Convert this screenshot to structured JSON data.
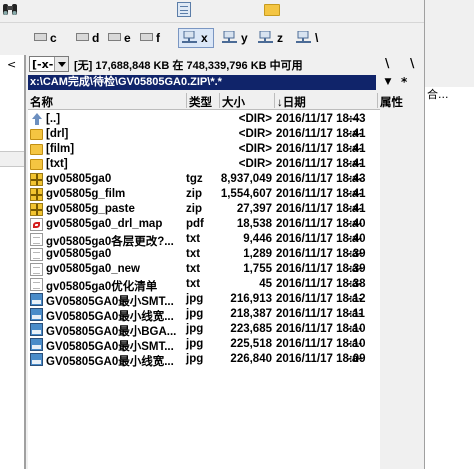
{
  "toolbar": {
    "icons": [
      "binoculars-icon",
      "calculator-icon",
      "folder-icon"
    ]
  },
  "drives": [
    {
      "letter": "c",
      "selected": false
    },
    {
      "letter": "d",
      "selected": false
    },
    {
      "letter": "e",
      "selected": false
    },
    {
      "letter": "f",
      "selected": false
    },
    {
      "letter": "x",
      "selected": true
    },
    {
      "letter": "y",
      "selected": false
    },
    {
      "letter": "z",
      "selected": false
    },
    {
      "letter": "\\",
      "selected": false
    }
  ],
  "drive_combo": {
    "value": "[-x-]"
  },
  "drive_info": "[无] 17,688,848 KB 在 748,339,796 KB 中可用",
  "path_bar": {
    "path": "x:\\CAM完成\\待检\\GV05805GA0.ZIP\\*.*",
    "star": "*",
    "backslash": "\\",
    "dropdown": "▼"
  },
  "right_panel": {
    "text": "合..."
  },
  "left_pane": {
    "arrow": "<"
  },
  "columns": {
    "name": "名称",
    "ext": "类型",
    "size": "大小",
    "date": "↓日期",
    "attr": "属性"
  },
  "files": [
    {
      "icon": "up",
      "name": "[..]",
      "ext": "",
      "size": "<DIR>",
      "date": "2016/11/17 18:43",
      "attr": "—"
    },
    {
      "icon": "folder",
      "name": "[drl]",
      "ext": "",
      "size": "<DIR>",
      "date": "2016/11/17 18:41",
      "attr": "-a-"
    },
    {
      "icon": "folder",
      "name": "[film]",
      "ext": "",
      "size": "<DIR>",
      "date": "2016/11/17 18:41",
      "attr": "-a-"
    },
    {
      "icon": "folder",
      "name": "[txt]",
      "ext": "",
      "size": "<DIR>",
      "date": "2016/11/17 18:41",
      "attr": "-a-"
    },
    {
      "icon": "zip",
      "name": "gv05805ga0",
      "ext": "tgz",
      "size": "8,937,049",
      "date": "2016/11/17 18:43",
      "attr": "-a-"
    },
    {
      "icon": "zip",
      "name": "gv05805g_film",
      "ext": "zip",
      "size": "1,554,607",
      "date": "2016/11/17 18:41",
      "attr": "-a-"
    },
    {
      "icon": "zip",
      "name": "gv05805g_paste",
      "ext": "zip",
      "size": "27,397",
      "date": "2016/11/17 18:41",
      "attr": "-a-"
    },
    {
      "icon": "pdf",
      "name": "gv05805ga0_drl_map",
      "ext": "pdf",
      "size": "18,538",
      "date": "2016/11/17 18:40",
      "attr": "-a-"
    },
    {
      "icon": "txt",
      "name": "gv05805ga0各层更改?...",
      "ext": "txt",
      "size": "9,446",
      "date": "2016/11/17 18:40",
      "attr": "-a-"
    },
    {
      "icon": "txt",
      "name": "gv05805ga0",
      "ext": "txt",
      "size": "1,289",
      "date": "2016/11/17 18:39",
      "attr": "-a-"
    },
    {
      "icon": "txt",
      "name": "gv05805ga0_new",
      "ext": "txt",
      "size": "1,755",
      "date": "2016/11/17 18:39",
      "attr": "-a-"
    },
    {
      "icon": "txt",
      "name": "gv05805ga0优化清单",
      "ext": "txt",
      "size": "45",
      "date": "2016/11/17 18:38",
      "attr": "-a-"
    },
    {
      "icon": "img",
      "name": "GV05805GA0最小SMT...",
      "ext": "jpg",
      "size": "216,913",
      "date": "2016/11/17 18:12",
      "attr": "-a-"
    },
    {
      "icon": "img",
      "name": "GV05805GA0最小线宽...",
      "ext": "jpg",
      "size": "218,387",
      "date": "2016/11/17 18:11",
      "attr": "-a-"
    },
    {
      "icon": "img",
      "name": "GV05805GA0最小BGA...",
      "ext": "jpg",
      "size": "223,685",
      "date": "2016/11/17 18:10",
      "attr": "-a-"
    },
    {
      "icon": "img",
      "name": "GV05805GA0最小SMT...",
      "ext": "jpg",
      "size": "225,518",
      "date": "2016/11/17 18:10",
      "attr": "-a-"
    },
    {
      "icon": "img",
      "name": "GV05805GA0最小线宽...",
      "ext": "jpg",
      "size": "226,840",
      "date": "2016/11/17 18:09",
      "attr": "-a-"
    }
  ]
}
